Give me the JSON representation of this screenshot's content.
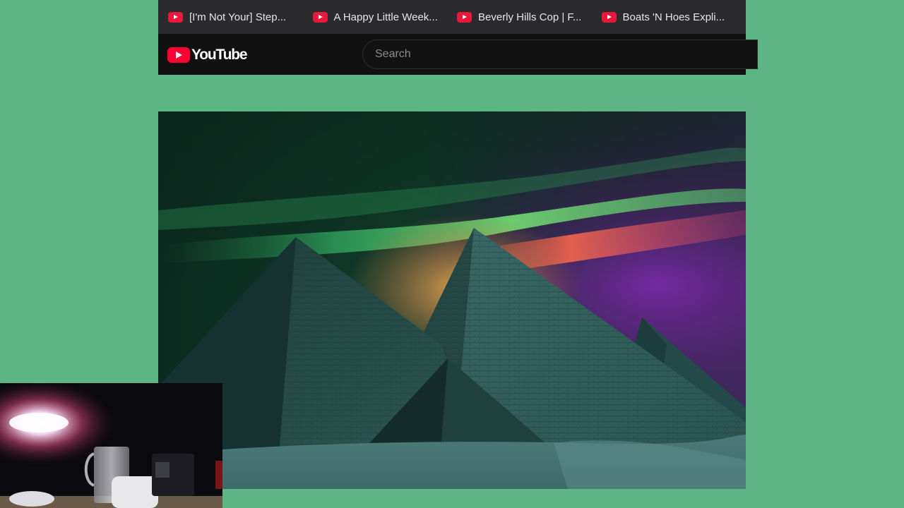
{
  "bookmarks_bar": {
    "items": [
      {
        "label": "[I'm Not Your] Step...",
        "icon": "youtube-favicon"
      },
      {
        "label": "A Happy Little Week...",
        "icon": "youtube-favicon"
      },
      {
        "label": "Beverly Hills Cop | F...",
        "icon": "youtube-favicon"
      },
      {
        "label": "Boats 'N Hoes Expli...",
        "icon": "youtube-favicon"
      }
    ]
  },
  "masthead": {
    "logo_text": "YouTube",
    "search_placeholder": "Search"
  },
  "video": {
    "scene": "pyramids-under-aurora"
  },
  "colors": {
    "page_background": "#5db584",
    "bookmarks_bar": "#2b2b2e",
    "masthead": "#111111",
    "youtube_red": "#ff0033"
  }
}
